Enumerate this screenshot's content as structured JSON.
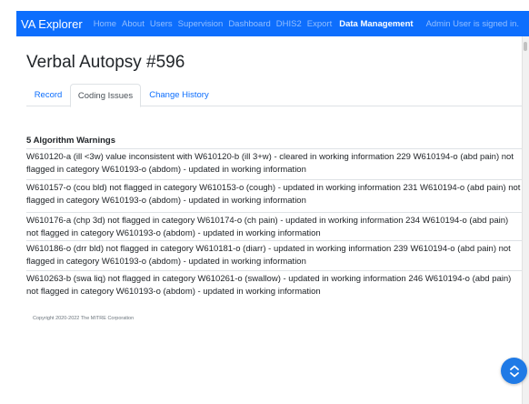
{
  "nav": {
    "brand": "VA Explorer",
    "links": [
      "Home",
      "About",
      "Users",
      "Supervision",
      "Dashboard",
      "DHIS2",
      "Export"
    ],
    "active_link": "Data Management",
    "signed_in": "Admin User is signed in."
  },
  "page": {
    "title": "Verbal Autopsy #596"
  },
  "tabs": [
    {
      "label": "Record"
    },
    {
      "label": "Coding Issues"
    },
    {
      "label": "Change History"
    }
  ],
  "active_tab": "Coding Issues",
  "warnings": {
    "header": "5 Algorithm Warnings",
    "items": [
      "W610120-a (ill <3w) value inconsistent with W610120-b (ill 3+w) - cleared in working information 229 W610194-o (abd pain) not flagged in category W610193-o (abdom) - updated in working information",
      "W610157-o (cou bld) not flagged in category W610153-o (cough) - updated in working information 231 W610194-o (abd pain) not flagged in category W610193-o (abdom) - updated in working information",
      "W610176-a (chp 3d) not flagged in category W610174-o (ch pain) - updated in working information 234 W610194-o (abd pain) not flagged in category W610193-o (abdom) - updated in working information",
      "W610186-o (drr bld) not flagged in category W610181-o (diarr) - updated in working information 239 W610194-o (abd pain) not flagged in category W610193-o (abdom) - updated in working information",
      "W610263-b (swa liq) not flagged in category W610261-o (swallow) - updated in working information 246 W610194-o (abd pain) not flagged in category W610193-o (abdom) - updated in working information"
    ]
  },
  "footer": {
    "copyright": "Copyright 2020-2022 The MITRE Corporation"
  },
  "colors": {
    "primary": "#0d6efd",
    "fab": "#1f7ae6"
  },
  "icons": {
    "fab": "up-down-chevrons-icon"
  }
}
